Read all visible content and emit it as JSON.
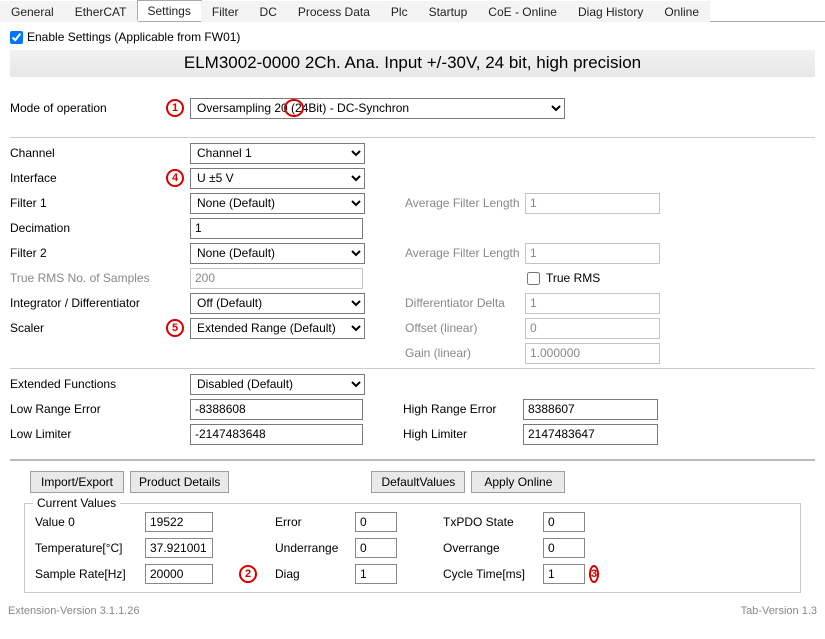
{
  "tabs": [
    "General",
    "EtherCAT",
    "Settings",
    "Filter",
    "DC",
    "Process Data",
    "Plc",
    "Startup",
    "CoE - Online",
    "Diag History",
    "Online"
  ],
  "active_tab": "Settings",
  "enable_settings_label": "Enable Settings (Applicable from FW01)",
  "banner": "ELM3002-0000 2Ch. Ana. Input +/-30V, 24 bit, high precision",
  "markers": {
    "m1": "1",
    "m2": "2",
    "m3": "3",
    "m4": "4",
    "m5": "5"
  },
  "mode_label": "Mode of operation",
  "mode_value": "Oversampling 20 (24Bit) - DC-Synchron",
  "left": {
    "channel_label": "Channel",
    "channel_value": "Channel 1",
    "interface_label": "Interface",
    "interface_value": "U ±5 V",
    "filter1_label": "Filter 1",
    "filter1_value": "None (Default)",
    "decimation_label": "Decimation",
    "decimation_value": "1",
    "filter2_label": "Filter 2",
    "filter2_value": "None (Default)",
    "truerms_no_label": "True RMS No. of Samples",
    "truerms_no_value": "200",
    "intdiff_label": "Integrator / Differentiator",
    "intdiff_value": "Off (Default)",
    "scaler_label": "Scaler",
    "scaler_value": "Extended Range (Default)",
    "extfunc_label": "Extended Functions",
    "extfunc_value": "Disabled (Default)",
    "lowrange_label": "Low Range Error",
    "lowrange_value": "-8388608",
    "lowlimiter_label": "Low Limiter",
    "lowlimiter_value": "-2147483648"
  },
  "right": {
    "avg1_label": "Average Filter Length",
    "avg1_value": "1",
    "avg2_label": "Average Filter Length",
    "avg2_value": "1",
    "truerms_cb_label": "True RMS",
    "diffdelta_label": "Differentiator Delta",
    "diffdelta_value": "1",
    "offset_label": "Offset (linear)",
    "offset_value": "0",
    "gain_label": "Gain (linear)",
    "gain_value": "1.000000",
    "highrange_label": "High Range Error",
    "highrange_value": "8388607",
    "highlimiter_label": "High Limiter",
    "highlimiter_value": "2147483647"
  },
  "buttons": {
    "import_export": "Import/Export",
    "product_details": "Product Details",
    "default_values": "DefaultValues",
    "apply_online": "Apply Online"
  },
  "current_values": {
    "legend": "Current Values",
    "value0_label": "Value 0",
    "value0": "19522",
    "temp_label": "Temperature[°C]",
    "temp": "37.921001",
    "sample_label": "Sample Rate[Hz]",
    "sample": "20000",
    "error_label": "Error",
    "error": "0",
    "underrange_label": "Underrange",
    "underrange": "0",
    "diag_label": "Diag",
    "diag": "1",
    "txpdo_label": "TxPDO State",
    "txpdo": "0",
    "overrange_label": "Overrange",
    "overrange": "0",
    "cycle_label": "Cycle Time[ms]",
    "cycle": "1"
  },
  "footer": {
    "left": "Extension-Version 3.1.1.26",
    "right": "Tab-Version 1.3"
  }
}
